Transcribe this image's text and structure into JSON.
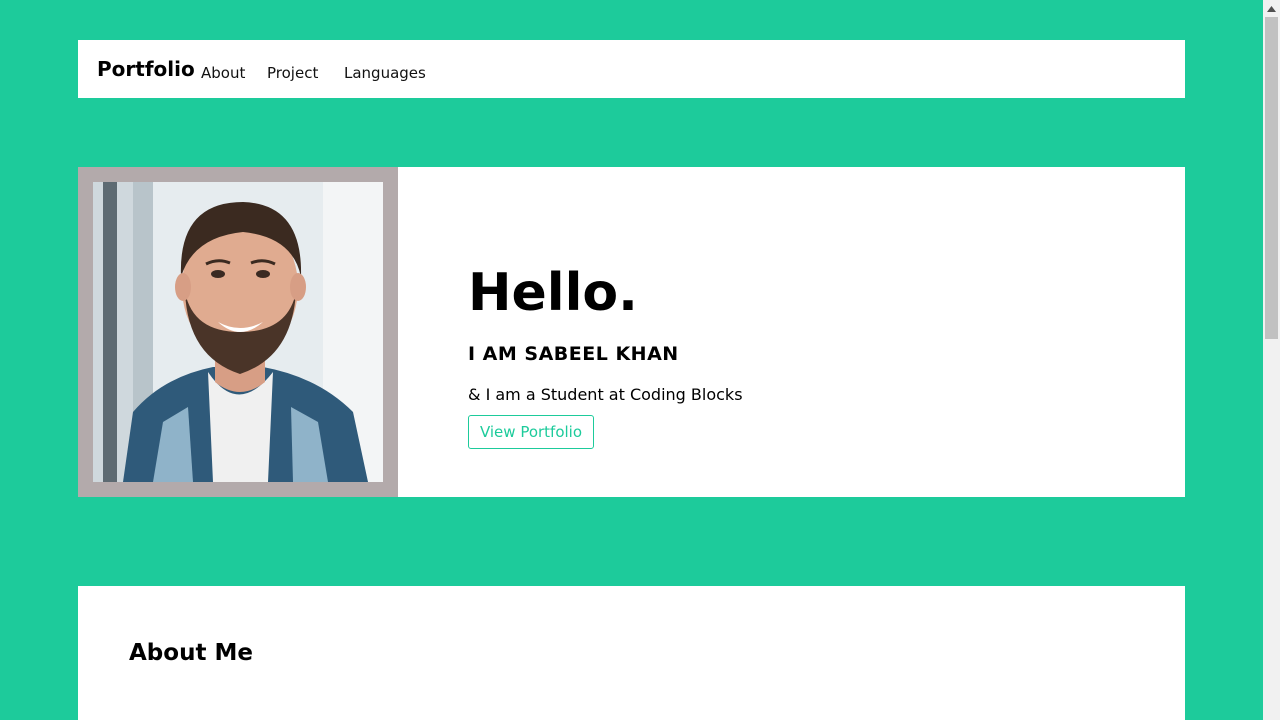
{
  "navbar": {
    "brand": "Portfolio",
    "links": [
      {
        "label": "About"
      },
      {
        "label": "Project"
      },
      {
        "label": "Languages"
      }
    ]
  },
  "hero": {
    "greeting": "Hello.",
    "name_line": "I AM SABEEL KHAN",
    "subtitle": "& I am a Student at Coding Blocks",
    "button_label": "View Portfolio"
  },
  "about": {
    "title": "About Me"
  },
  "colors": {
    "background": "#1dcb9b",
    "accent": "#1dcb9b",
    "photo_frame": "#b3aaab"
  },
  "icons": {
    "scroll_up": "triangle-up-icon"
  }
}
